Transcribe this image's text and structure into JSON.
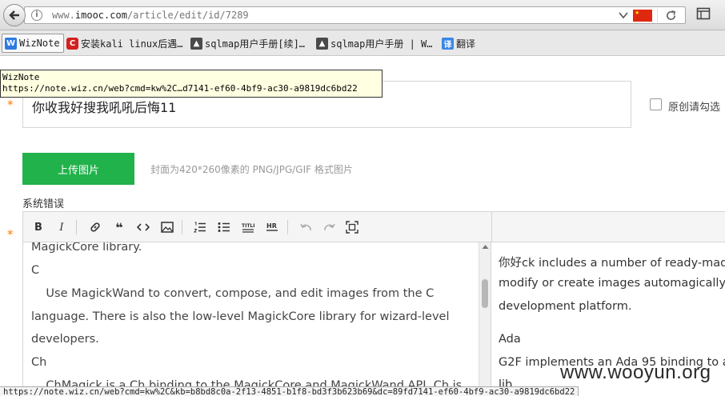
{
  "browser": {
    "url_prefix": "www.",
    "url_domain": "imooc.com",
    "url_path": "/article/edit/id/7289",
    "status_url": "https://note.wiz.cn/web?cmd=kw%2C&kb=b8bd8c0a-2f13-4851-b1f8-bd3f3b623b69&dc=89fd7141-ef60-4bf9-ac30-a9819dc6bd22"
  },
  "bookmarks": [
    {
      "label": "WizNote",
      "icon": "wiznote-icon"
    },
    {
      "label": "安装kali linux后遇…",
      "icon": "c-logo-icon"
    },
    {
      "label": "sqlmap用户手册[续]…",
      "icon": "hacker-icon"
    },
    {
      "label": "sqlmap用户手册 | W…",
      "icon": "hacker-icon"
    },
    {
      "label": "翻译",
      "icon": "translate-icon"
    }
  ],
  "tooltip": {
    "line1": "WizNote",
    "line2": "https://note.wiz.cn/web?cmd=kw%2C…d7141-ef60-4bf9-ac30-a9819dc6bd22"
  },
  "form": {
    "required_mark": "*",
    "title_value": "你收我好搜我吼吼后悔11",
    "original_label": "原创请勾选",
    "upload_label": "上传图片",
    "upload_hint": "封面为420*260像素的 PNG/JPG/GIF 格式图片",
    "system_error": "系统错误"
  },
  "editor": {
    "lines": [
      "MagickCore library.",
      "C",
      "    Use MagickWand to convert, compose, and edit images from the C",
      "language. There is also the low-level MagickCore library for wizard-level",
      "developers.",
      "Ch",
      "    ChMagick is a Ch binding to the MagickCore and MagickWand API. Ch is"
    ]
  },
  "preview": {
    "lines": [
      "你好ck includes a number of ready-made",
      "modify or create images automagically a",
      "development platform.",
      "Ada",
      "G2F implements an Ada 95 binding to a",
      "lib"
    ]
  },
  "watermark": "www.wooyun.org",
  "colors": {
    "upload_green": "#21b24b",
    "required_orange": "#ff7a00",
    "flag_red": "#de2910"
  }
}
